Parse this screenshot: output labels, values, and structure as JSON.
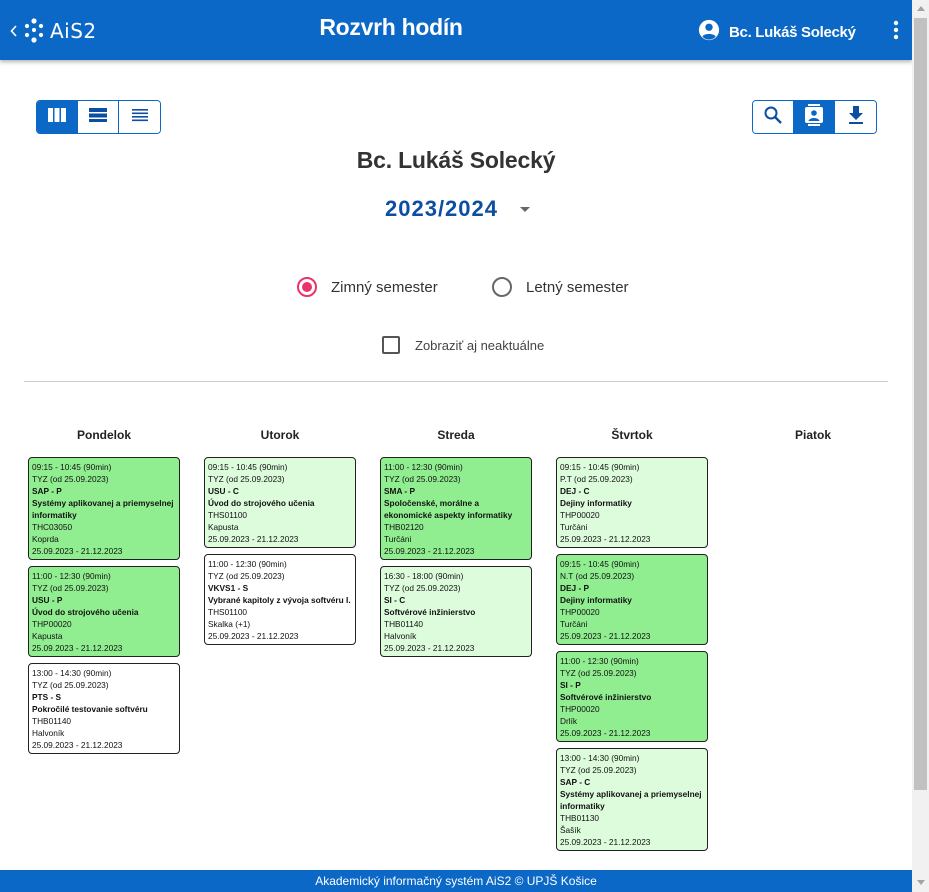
{
  "header": {
    "logo_text": "AiS2",
    "title": "Rozvrh hodín",
    "user_name": "Bc. Lukáš Solecký",
    "bar_color": "#0b68c6"
  },
  "view_toggle": {
    "items": [
      {
        "icon": "columns-icon",
        "active": true
      },
      {
        "icon": "rows-icon",
        "active": false
      },
      {
        "icon": "list-icon",
        "active": false
      }
    ]
  },
  "actions": {
    "items": [
      {
        "icon": "search-icon",
        "active": false
      },
      {
        "icon": "contact-card-icon",
        "active": true
      },
      {
        "icon": "download-icon",
        "active": false
      }
    ]
  },
  "person_name": "Bc. Lukáš Solecký",
  "academic_year": "2023/2024",
  "semesters": {
    "winter": {
      "label": "Zimný semester",
      "checked": true
    },
    "summer": {
      "label": "Letný semester",
      "checked": false
    }
  },
  "show_inactive": {
    "label": "Zobraziť aj neaktuálne",
    "checked": false
  },
  "days": [
    {
      "name": "Pondelok",
      "cards": [
        {
          "time": "09:15 - 10:45 (90min)",
          "week": "TYZ (od 25.09.2023)",
          "code": "SAP - P",
          "subject": "Systémy aplikovanej a priemyselnej informatiky",
          "room": "THC03050",
          "teacher": "Koprda",
          "dates": "25.09.2023 - 21.12.2023",
          "color": "dark"
        },
        {
          "time": "11:00 - 12:30 (90min)",
          "week": "TYZ (od 25.09.2023)",
          "code": "USU - P",
          "subject": "Úvod do strojového učenia",
          "room": "THP00020",
          "teacher": "Kapusta",
          "dates": "25.09.2023 - 21.12.2023",
          "color": "dark"
        },
        {
          "time": "13:00 - 14:30 (90min)",
          "week": "TYZ (od 25.09.2023)",
          "code": "PTS - S",
          "subject": "Pokročilé testovanie softvéru",
          "room": "THB01140",
          "teacher": "Halvoník",
          "dates": "25.09.2023 - 21.12.2023",
          "color": "white"
        }
      ]
    },
    {
      "name": "Utorok",
      "cards": [
        {
          "time": "09:15 - 10:45 (90min)",
          "week": "TYZ (od 25.09.2023)",
          "code": "USU - C",
          "subject": "Úvod do strojového učenia",
          "room": "THS01100",
          "teacher": "Kapusta",
          "dates": "25.09.2023 - 21.12.2023",
          "color": "light"
        },
        {
          "time": "11:00 - 12:30 (90min)",
          "week": "TYZ (od 25.09.2023)",
          "code": "VKVS1 - S",
          "subject": "Vybrané kapitoly z vývoja softvéru I.",
          "room": "THS01100",
          "teacher": "Skalka (+1)",
          "dates": "25.09.2023 - 21.12.2023",
          "color": "white"
        }
      ]
    },
    {
      "name": "Streda",
      "cards": [
        {
          "time": "11:00 - 12:30 (90min)",
          "week": "TYZ (od 25.09.2023)",
          "code": "SMA - P",
          "subject": "Spoločenské, morálne a ekonomické aspekty informatiky",
          "room": "THB02120",
          "teacher": "Turčáni",
          "dates": "25.09.2023 - 21.12.2023",
          "color": "dark"
        },
        {
          "time": "16:30 - 18:00 (90min)",
          "week": "TYZ (od 25.09.2023)",
          "code": "SI - C",
          "subject": "Softvérové inžinierstvo",
          "room": "THB01140",
          "teacher": "Halvoník",
          "dates": "25.09.2023 - 21.12.2023",
          "color": "light"
        }
      ]
    },
    {
      "name": "Štvrtok",
      "cards": [
        {
          "time": "09:15 - 10:45 (90min)",
          "week": "P.T (od 25.09.2023)",
          "code": "DEJ - C",
          "subject": "Dejiny informatiky",
          "room": "THP00020",
          "teacher": "Turčáni",
          "dates": "25.09.2023 - 21.12.2023",
          "color": "light"
        },
        {
          "time": "09:15 - 10:45 (90min)",
          "week": "N.T (od 25.09.2023)",
          "code": "DEJ - P",
          "subject": "Dejiny informatiky",
          "room": "THP00020",
          "teacher": "Turčáni",
          "dates": "25.09.2023 - 21.12.2023",
          "color": "dark"
        },
        {
          "time": "11:00 - 12:30 (90min)",
          "week": "TYZ (od 25.09.2023)",
          "code": "SI - P",
          "subject": "Softvérové inžinierstvo",
          "room": "THP00020",
          "teacher": "Drlík",
          "dates": "25.09.2023 - 21.12.2023",
          "color": "dark"
        },
        {
          "time": "13:00 - 14:30 (90min)",
          "week": "TYZ (od 25.09.2023)",
          "code": "SAP - C",
          "subject": "Systémy aplikovanej a priemyselnej informatiky",
          "room": "THB01130",
          "teacher": "Šašík",
          "dates": "25.09.2023 - 21.12.2023",
          "color": "light"
        }
      ]
    },
    {
      "name": "Piatok",
      "cards": []
    }
  ],
  "footer": "Akademický informačný systém AiS2 © UPJŠ Košice"
}
